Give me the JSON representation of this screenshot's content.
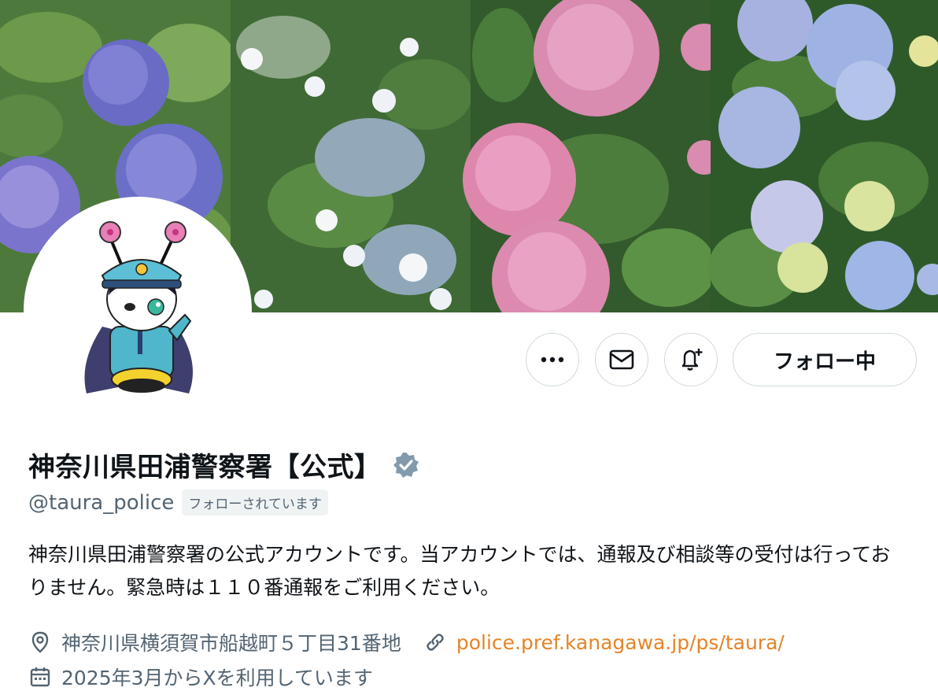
{
  "banner": {
    "icon": "hydrangea-photo-collage"
  },
  "avatar": {
    "icon": "police-mascot-character"
  },
  "actions": {
    "more_icon": "ellipsis-icon",
    "message_icon": "mail-icon",
    "notify_icon": "bell-plus-icon",
    "follow_label": "フォロー中"
  },
  "profile": {
    "display_name": "神奈川県田浦警察署【公式】",
    "verified_icon": "verified-badge-icon",
    "verified_color": "#829aab",
    "handle": "@taura_police",
    "follows_you": "フォローされています",
    "bio": "神奈川県田浦警察署の公式アカウントです。当アカウントでは、通報及び相談等の受付は行っておりません。緊急時は１１０番通報をご利用ください。",
    "location": "神奈川県横須賀市船越町５丁目31番地",
    "url": "police.pref.kanagawa.jp/ps/taura/",
    "url_color": "#e58428",
    "joined": "2025年3月からXを利用しています"
  }
}
